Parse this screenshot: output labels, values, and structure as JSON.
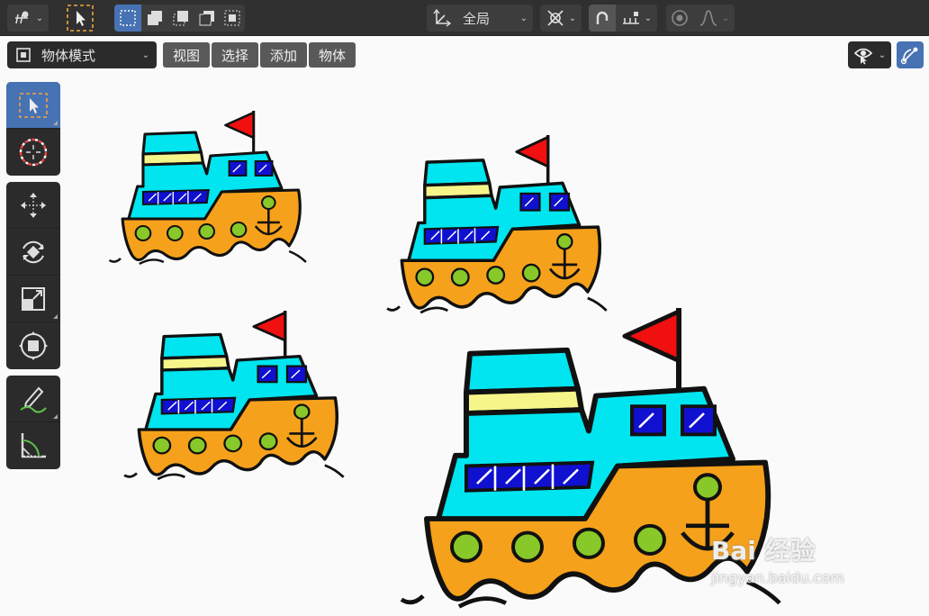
{
  "header": {
    "transform_orientation": "全局",
    "mode": "物体模式",
    "menus": [
      "视图",
      "选择",
      "添加",
      "物体"
    ]
  },
  "watermark": {
    "main": "Bai 经验",
    "sub": "jingyan.baidu.com"
  },
  "colors": {
    "topbar_bg": "#303030",
    "button_bg": "#3d3d3d",
    "accent": "#4772b3",
    "menu_bg": "#595959",
    "cabin_cyan": "#00e5f0",
    "hull_orange": "#f6a11b",
    "flag_red": "#f01010",
    "stripe_yellow": "#f5f58a",
    "window_blue": "#1010d0",
    "porthole_green": "#88c828"
  },
  "toolbar_icons": [
    "select-box-icon",
    "cursor-icon",
    "move-icon",
    "rotate-icon",
    "scale-icon",
    "transform-icon",
    "annotate-icon",
    "measure-icon"
  ]
}
